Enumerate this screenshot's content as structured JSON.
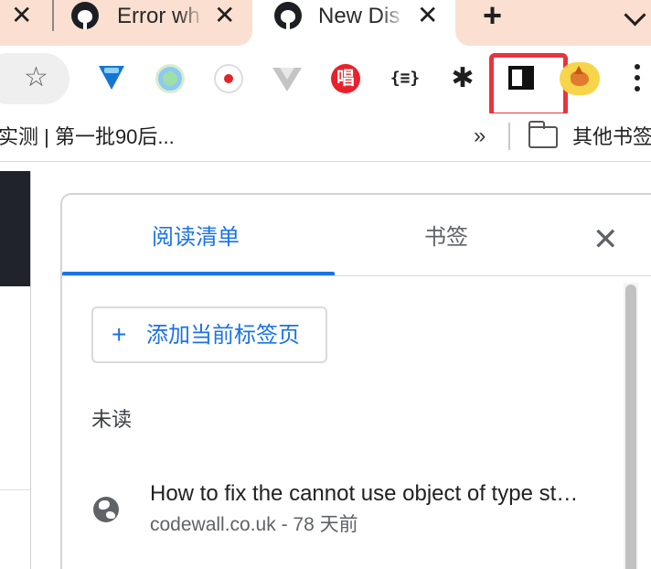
{
  "tabs": [
    {
      "title": "",
      "active": false
    },
    {
      "title": "Error wh",
      "active": false
    },
    {
      "title": "New Dis",
      "active": true
    }
  ],
  "tabstrip": {
    "close_glyph": "✕",
    "new_tab_glyph": "+",
    "tab_search_icon": "chevron-down-icon"
  },
  "toolbar": {
    "star_glyph": "☆",
    "extensions": [
      {
        "name": "diamond-extension-icon"
      },
      {
        "name": "circle-extension-icon"
      },
      {
        "name": "record-extension-icon"
      },
      {
        "name": "vue-devtools-icon"
      },
      {
        "name": "chang-extension-icon",
        "glyph": "唱"
      },
      {
        "name": "json-extension-icon",
        "glyph": "{≡}"
      },
      {
        "name": "puzzle-icon",
        "glyph": "✱"
      }
    ],
    "side_panel_icon": "side-panel-icon",
    "highlight_color": "#e8343e"
  },
  "bookmarks": {
    "first_item": "实测 | 第一批90后...",
    "overflow_glyph": "»",
    "other_bookmarks": "其他书签"
  },
  "side_panel": {
    "tabs": [
      {
        "label": "阅读清单",
        "active": true
      },
      {
        "label": "书签",
        "active": false
      }
    ],
    "close_glyph": "✕",
    "add_button": {
      "plus": "+",
      "label": "添加当前标签页"
    },
    "section_unread": "未读",
    "items": [
      {
        "title": "How to fix the cannot use object of type stdClass as array",
        "meta": "codewall.co.uk - 78 天前"
      }
    ],
    "accent_color": "#1a73e8"
  }
}
